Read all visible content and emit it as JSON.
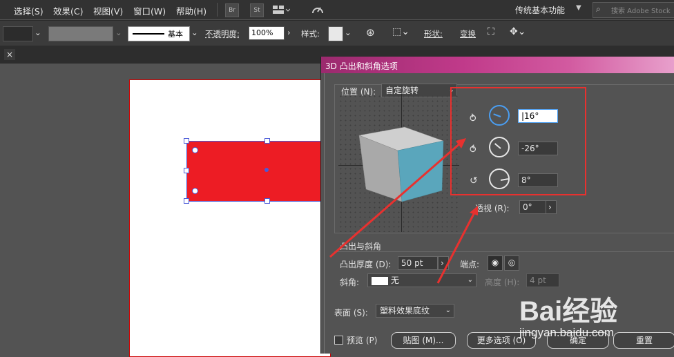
{
  "menubar": {
    "items": [
      "选择(S)",
      "效果(C)",
      "视图(V)",
      "窗口(W)",
      "帮助(H)"
    ],
    "icons": [
      "br-bridge-icon",
      "st-stock-icon",
      "arrange-documents-icon",
      "gpu-performance-icon"
    ],
    "workspace": "传统基本功能",
    "search_placeholder": "搜索 Adobe Stock"
  },
  "controlbar": {
    "stroke_style": "基本",
    "opacity_label": "不透明度:",
    "opacity_value": "100%",
    "style_label": "样式:",
    "shape_label": "形状:",
    "transform_label": "变换"
  },
  "dialog": {
    "title": "3D 凸出和斜角选项",
    "position_label": "位置 (N):",
    "position_value": "自定旋转",
    "rotation": {
      "x_value": "16°",
      "y_value": "-26°",
      "z_value": "8°"
    },
    "perspective_label": "透视 (R):",
    "perspective_value": "0°",
    "extrude_section": "凸出与斜角",
    "depth_label": "凸出厚度 (D):",
    "depth_value": "50 pt",
    "cap_label": "端点:",
    "bevel_label": "斜角:",
    "bevel_value": "无",
    "height_label": "高度 (H):",
    "height_value": "4 pt",
    "surface_label": "表面 (S):",
    "surface_value": "塑料效果底纹",
    "preview_label": "预览 (P)",
    "buttons": {
      "map": "贴图 (M)...",
      "more_options": "更多选项 (O)",
      "ok": "确定",
      "reset": "重置"
    }
  },
  "annotations": {
    "highlight_color": "#e8312f"
  },
  "watermark": {
    "text": "Bai经验",
    "url": "jingyan.baidu.com"
  }
}
